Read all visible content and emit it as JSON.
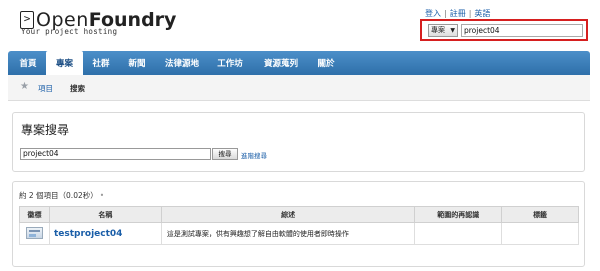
{
  "header": {
    "logo_prompt": ">",
    "logo_open": "Open",
    "logo_foundry": "Foundry",
    "tagline": "Your project hosting",
    "links": [
      "登入",
      "註冊",
      "英語"
    ],
    "search": {
      "scope": "專案",
      "value": "project04"
    }
  },
  "nav": {
    "items": [
      "首頁",
      "專案",
      "社群",
      "新聞",
      "法律源地",
      "工作坊",
      "資源蒐列",
      "關於"
    ],
    "active_index": 1
  },
  "subnav": {
    "link": "項目",
    "current": "搜索"
  },
  "search_panel": {
    "title": "專案搜尋",
    "query": "project04",
    "button": "搜尋",
    "advanced_link": "進階搜尋"
  },
  "results": {
    "count_text": "約 2 個項目（0.02秒）",
    "bullet": "•",
    "columns": [
      "徽標",
      "名稱",
      "綜述",
      "範圍的再認識",
      "標籤"
    ],
    "rows": [
      {
        "name": "testproject04",
        "summary": "這是測試專案，供有興趣想了解自由軟體的使用者即時操作",
        "scope": "",
        "tags": ""
      }
    ]
  },
  "colors": {
    "nav_blue": "#3a7dba",
    "link_blue": "#1a5ea8",
    "highlight_red": "#d61f1f"
  }
}
